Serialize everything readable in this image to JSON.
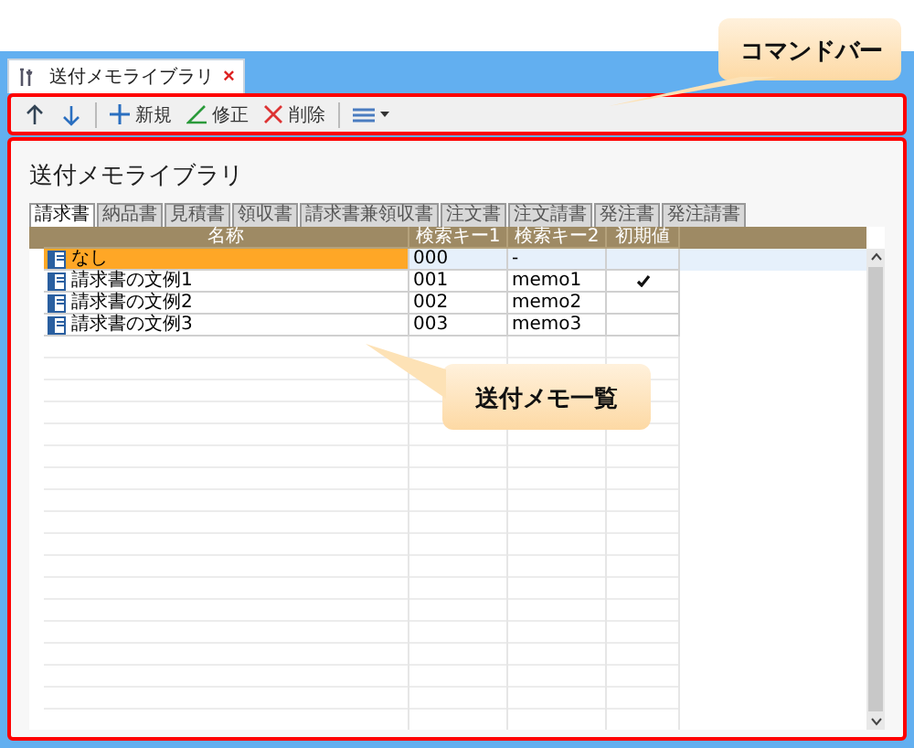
{
  "window_tab": {
    "title": "送付メモライブラリ",
    "close": "×"
  },
  "toolbar": {
    "buttons": [
      {
        "kind": "up"
      },
      {
        "kind": "down"
      },
      {
        "kind": "new",
        "label": "新規"
      },
      {
        "kind": "edit",
        "label": "修正"
      },
      {
        "kind": "delete",
        "label": "削除"
      },
      {
        "kind": "view"
      }
    ]
  },
  "page_title": "送付メモライブラリ",
  "doc_tabs": [
    {
      "label": "請求書",
      "selected": true
    },
    {
      "label": "納品書",
      "selected": false
    },
    {
      "label": "見積書",
      "selected": false
    },
    {
      "label": "領収書",
      "selected": false
    },
    {
      "label": "請求書兼領収書",
      "selected": false
    },
    {
      "label": "注文書",
      "selected": false
    },
    {
      "label": "注文請書",
      "selected": false
    },
    {
      "label": "発注書",
      "selected": false
    },
    {
      "label": "発注請書",
      "selected": false
    }
  ],
  "table": {
    "columns": [
      "名称",
      "検索キー1",
      "検索キー2",
      "初期値"
    ],
    "rows": [
      {
        "name": "なし",
        "key1": "000",
        "key2": "-",
        "default": false,
        "selected": true
      },
      {
        "name": "請求書の文例1",
        "key1": "001",
        "key2": "memo1",
        "default": true,
        "selected": false
      },
      {
        "name": "請求書の文例2",
        "key1": "002",
        "key2": "memo2",
        "default": false,
        "selected": false
      },
      {
        "name": "請求書の文例3",
        "key1": "003",
        "key2": "memo3",
        "default": false,
        "selected": false
      }
    ]
  },
  "callouts": [
    {
      "text": "コマンドバー"
    },
    {
      "text": "送付メモ一覧"
    }
  ]
}
